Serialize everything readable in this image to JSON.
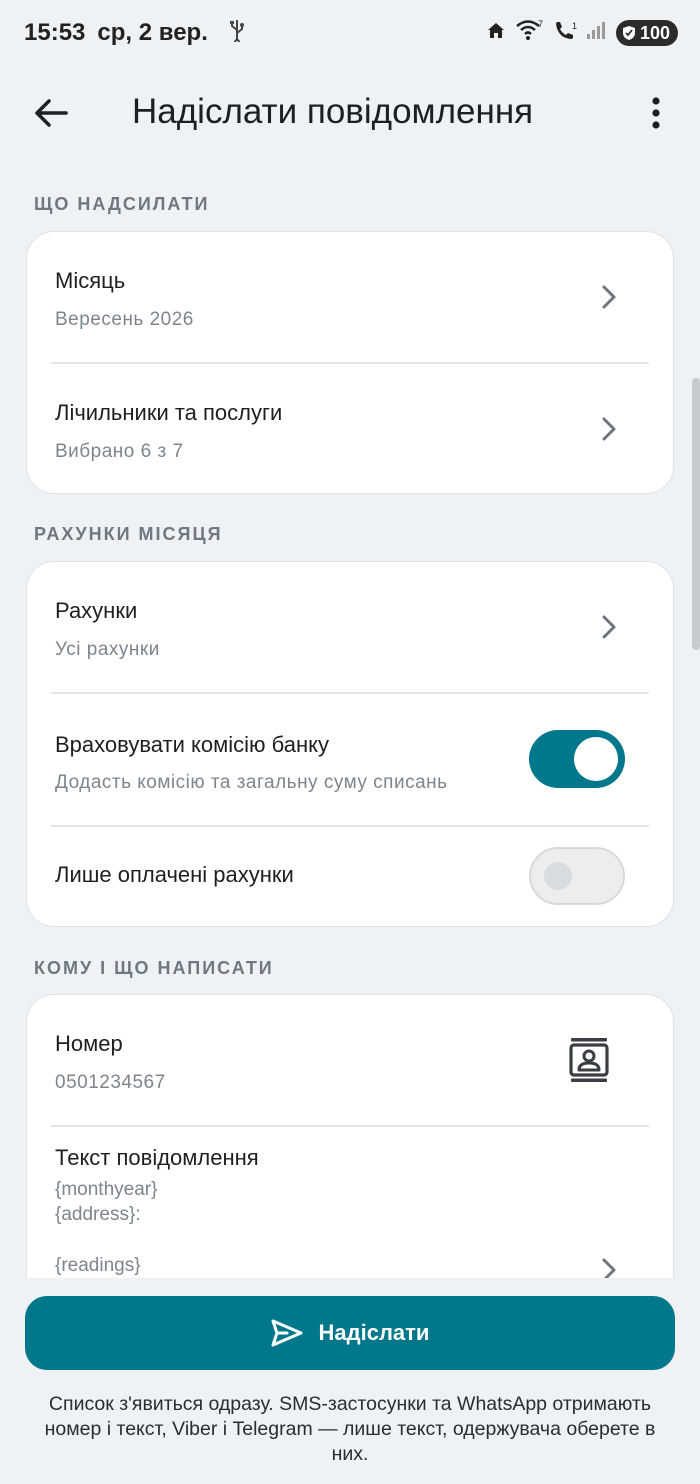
{
  "status_bar": {
    "time": "15:53",
    "date": "ср, 2 вер.",
    "battery": "100",
    "icons": [
      "usb-icon",
      "home-icon",
      "wifi-icon",
      "wifi-call-icon",
      "signal-icon",
      "battery-icon"
    ]
  },
  "app_bar": {
    "title": "Надіслати повідомлення",
    "back_icon": "arrow-left-icon",
    "menu_icon": "more-vert-icon"
  },
  "sections": {
    "what": {
      "header": "ЩО НАДСИЛАТИ",
      "month": {
        "title": "Місяць",
        "value": "Вересень 2026"
      },
      "meters": {
        "title": "Лічильники та послуги",
        "value": "Вибрано 6 з 7"
      }
    },
    "bills": {
      "header": "РАХУНКИ МІСЯЦЯ",
      "bills_row": {
        "title": "Рахунки",
        "value": "Усі рахунки"
      },
      "commission": {
        "title": "Враховувати комісію банку",
        "value": "Додасть комісію та загальну суму списань",
        "checked": true
      },
      "paid_only": {
        "title": "Лише оплачені рахунки",
        "checked": false
      }
    },
    "message": {
      "header": "КОМУ І ЩО НАПИСАТИ",
      "number": {
        "title": "Номер",
        "value": "0501234567"
      },
      "text": {
        "title": "Текст повідомлення",
        "lines": [
          "{monthyear}",
          "{address}:",
          "",
          "{readings}"
        ]
      }
    }
  },
  "send_button": {
    "label": "Надіслати"
  },
  "hint": "Список з'явиться одразу. SMS-застосунки та WhatsApp отримають номер і текст, Viber і Telegram — лише текст, одержувача оберете в них.",
  "colors": {
    "accent": "#00778a",
    "background": "#eef2f5",
    "card": "#ffffff"
  }
}
